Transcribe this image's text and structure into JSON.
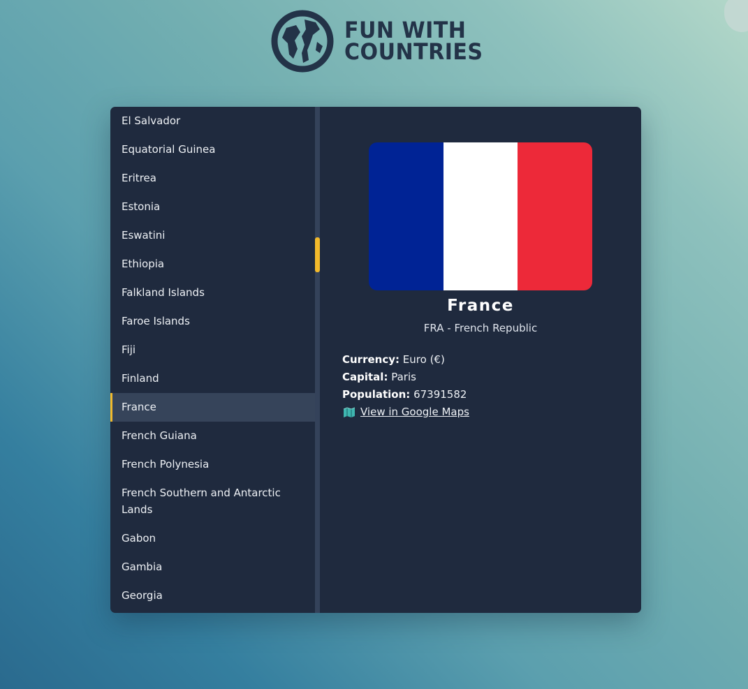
{
  "logo": {
    "line1": "FUN WITH",
    "line2": "COUNTRIES",
    "color": "#233348"
  },
  "countries": [
    {
      "name": "El Salvador"
    },
    {
      "name": "Equatorial Guinea"
    },
    {
      "name": "Eritrea"
    },
    {
      "name": "Estonia"
    },
    {
      "name": "Eswatini"
    },
    {
      "name": "Ethiopia"
    },
    {
      "name": "Falkland Islands"
    },
    {
      "name": "Faroe Islands"
    },
    {
      "name": "Fiji"
    },
    {
      "name": "Finland"
    },
    {
      "name": "France",
      "selected": true
    },
    {
      "name": "French Guiana"
    },
    {
      "name": "French Polynesia"
    },
    {
      "name": "French Southern and Antarctic Lands"
    },
    {
      "name": "Gabon"
    },
    {
      "name": "Gambia"
    },
    {
      "name": "Georgia"
    }
  ],
  "accent_color": "#f2b92b",
  "detail": {
    "name": "France",
    "subtitle": "FRA - French Republic",
    "flag_colors": [
      "#002395",
      "#ffffff",
      "#ed2939"
    ],
    "currency_label": "Currency:",
    "currency_value": "Euro (€)",
    "capital_label": "Capital:",
    "capital_value": "Paris",
    "population_label": "Population:",
    "population_value": "67391582",
    "maps_icon": "map-icon",
    "maps_link": "View in Google Maps"
  }
}
